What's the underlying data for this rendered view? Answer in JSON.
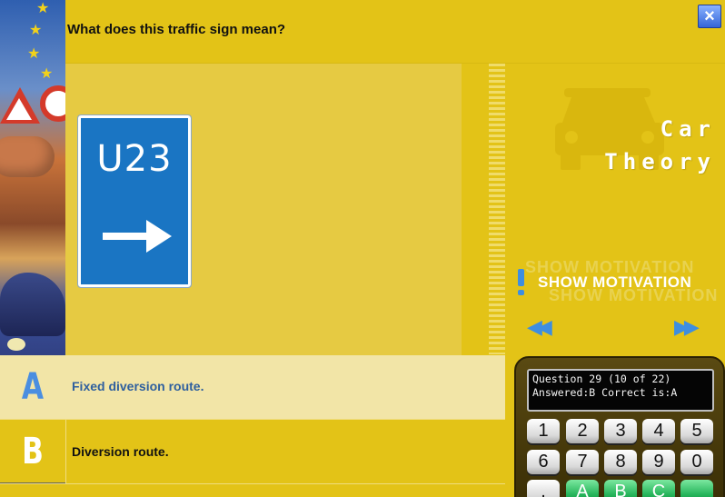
{
  "header": {
    "question": "What does this traffic sign mean?",
    "close_icon": "×"
  },
  "sign": {
    "code": "U23",
    "arrow_icon": "arrow-right-icon",
    "color": "#1a75c3"
  },
  "brand": {
    "line1": "Car",
    "line2": "Theory"
  },
  "motivation": {
    "label": "SHOW MOTIVATION"
  },
  "nav": {
    "prev": "◀◀",
    "next": "▶▶"
  },
  "answers": [
    {
      "letter": "A",
      "text": "Fixed diversion route."
    },
    {
      "letter": "B",
      "text": "Diversion route."
    }
  ],
  "device": {
    "line1": "Question 29 (10 of 22)",
    "line2": "Answered:B Correct is:A",
    "keys": [
      "1",
      "2",
      "3",
      "4",
      "5",
      "6",
      "7",
      "8",
      "9",
      "0",
      ",",
      "A",
      "B",
      "C",
      ""
    ]
  },
  "colors": {
    "background": "#e3c317",
    "accent_blue": "#3e8ee0",
    "selected_answer_bg": "#f2e5a7"
  }
}
